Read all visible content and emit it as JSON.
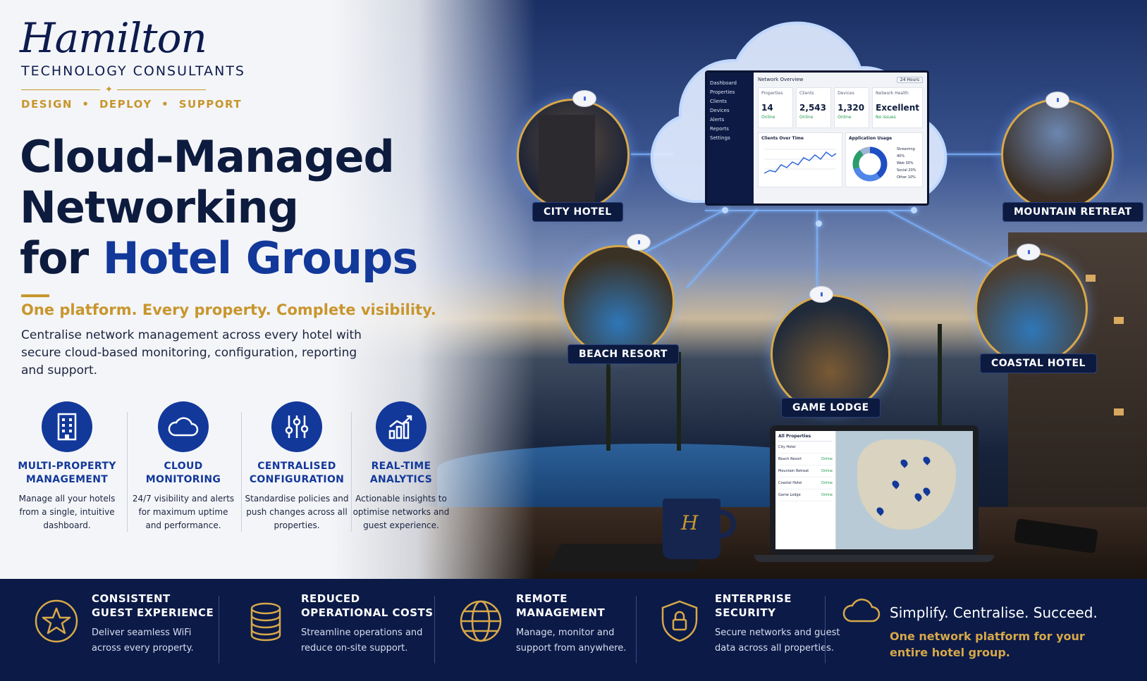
{
  "brand": {
    "name": "Hamilton",
    "subtitle": "TECHNOLOGY CONSULTANTS",
    "tagline": [
      "DESIGN",
      "DEPLOY",
      "SUPPORT"
    ]
  },
  "hero": {
    "headline_line1": "Cloud-Managed",
    "headline_line2": "Networking",
    "headline_line3_prefix": "for",
    "headline_line3_accent": "Hotel Groups",
    "tagline": "One platform. Every property. Complete visibility.",
    "intro": "Centralise network management across every hotel with secure cloud-based monitoring, configuration, reporting and support."
  },
  "features": [
    {
      "icon": "building-icon",
      "title_l1": "MULTI-PROPERTY",
      "title_l2": "MANAGEMENT",
      "desc": "Manage all your hotels from a single, intuitive dashboard."
    },
    {
      "icon": "cloud-icon",
      "title_l1": "CLOUD",
      "title_l2": "MONITORING",
      "desc": "24/7 visibility and alerts for maximum uptime and performance."
    },
    {
      "icon": "sliders-icon",
      "title_l1": "CENTRALISED",
      "title_l2": "CONFIGURATION",
      "desc": "Standardise policies and push changes across all properties."
    },
    {
      "icon": "chart-icon",
      "title_l1": "REAL-TIME",
      "title_l2": "ANALYTICS",
      "desc": "Actionable insights to optimise networks and guest experience."
    }
  ],
  "dashboard": {
    "nav": [
      "Dashboard",
      "Properties",
      "Clients",
      "Devices",
      "Alerts",
      "Reports",
      "Settings"
    ],
    "title": "Network Overview",
    "range": "24 Hours",
    "cards": [
      {
        "label": "Properties",
        "value": "14",
        "status": "Online"
      },
      {
        "label": "Clients",
        "value": "2,543",
        "status": "Online"
      },
      {
        "label": "Devices",
        "value": "1,320",
        "status": "Online"
      },
      {
        "label": "Network Health",
        "value": "Excellent",
        "status": "No issues"
      }
    ],
    "clients_panel": "Clients Over Time",
    "apps_panel": "Application Usage",
    "app_usage": [
      {
        "name": "Streaming",
        "pct": "40%",
        "share": 40,
        "color": "#1f4fc2"
      },
      {
        "name": "Web",
        "pct": "30%",
        "share": 30,
        "color": "#4f86e8"
      },
      {
        "name": "Social",
        "pct": "20%",
        "share": 20,
        "color": "#2a9d6a"
      },
      {
        "name": "Other",
        "pct": "10%",
        "share": 10,
        "color": "#9fb4d6"
      }
    ]
  },
  "properties": {
    "city": "CITY HOTEL",
    "mountain": "MOUNTAIN RETREAT",
    "beach": "BEACH RESORT",
    "coastal": "COASTAL HOTEL",
    "lodge": "GAME LODGE"
  },
  "laptop": {
    "header": "All Properties",
    "rows": [
      {
        "name": "City Hotel",
        "status": ""
      },
      {
        "name": "Beach Resort",
        "status": "Online"
      },
      {
        "name": "Mountain Retreat",
        "status": "Online"
      },
      {
        "name": "Coastal Hotel",
        "status": "Online"
      },
      {
        "name": "Game Lodge",
        "status": "Online"
      }
    ]
  },
  "mug_letter": "H",
  "footer": {
    "items": [
      {
        "icon": "star-icon",
        "title_l1": "CONSISTENT",
        "title_l2": "GUEST EXPERIENCE",
        "desc_l1": "Deliver seamless WiFi",
        "desc_l2": "across every property."
      },
      {
        "icon": "coins-icon",
        "title_l1": "REDUCED",
        "title_l2": "OPERATIONAL COSTS",
        "desc_l1": "Streamline operations and",
        "desc_l2": "reduce on-site support."
      },
      {
        "icon": "globe-icon",
        "title_l1": "REMOTE",
        "title_l2": "MANAGEMENT",
        "desc_l1": "Manage, monitor and",
        "desc_l2": "support from anywhere."
      },
      {
        "icon": "shield-lock-icon",
        "title_l1": "ENTERPRISE",
        "title_l2": "SECURITY",
        "desc_l1": "Secure networks and guest",
        "desc_l2": "data across all properties."
      }
    ],
    "slogan": "Simplify. Centralise. Succeed.",
    "slogan_sub_l1": "One network platform for your",
    "slogan_sub_l2": "entire hotel group."
  },
  "colors": {
    "navy": "#0b1a47",
    "royal": "#12389a",
    "gold": "#c8962d"
  }
}
